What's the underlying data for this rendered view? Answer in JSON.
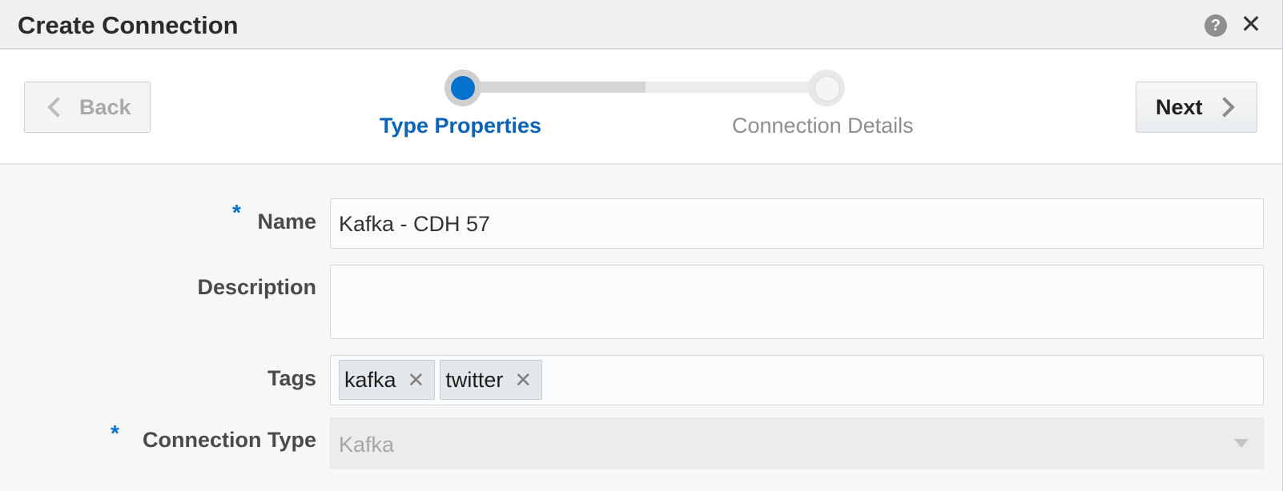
{
  "dialog": {
    "title": "Create Connection",
    "help_icon": "question-circle-icon",
    "help_glyph": "?",
    "close_icon": "close-icon",
    "close_glyph": "✕"
  },
  "train": {
    "back_label": "Back",
    "next_label": "Next",
    "steps": [
      {
        "label": "Type Properties",
        "state": "current"
      },
      {
        "label": "Connection Details",
        "state": "upcoming"
      }
    ],
    "active_color": "#0572ce"
  },
  "form": {
    "required_marker": "*",
    "name": {
      "label": "Name",
      "value": "Kafka - CDH 57",
      "required": true
    },
    "description": {
      "label": "Description",
      "value": ""
    },
    "tags": {
      "label": "Tags",
      "items": [
        {
          "text": "kafka",
          "remove_glyph": "✕"
        },
        {
          "text": "twitter",
          "remove_glyph": "✕"
        }
      ]
    },
    "connection_type": {
      "label": "Connection Type",
      "value": "Kafka",
      "required": true,
      "disabled": true
    }
  }
}
